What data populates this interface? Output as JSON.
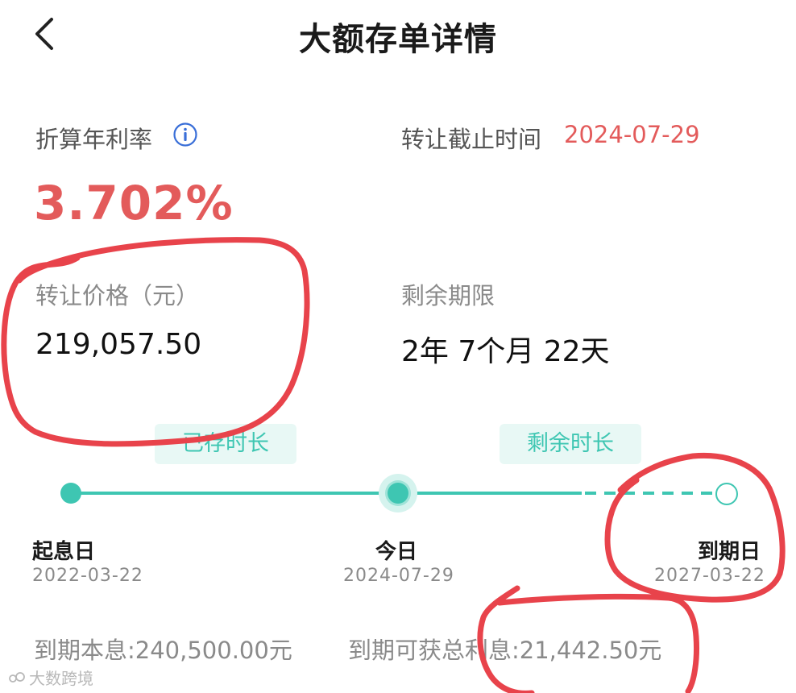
{
  "header": {
    "back_icon": "chevron-left-icon",
    "title": "大额存单详情"
  },
  "rate": {
    "label": "折算年利率",
    "value": "3.702%",
    "info_icon": "info-icon"
  },
  "deadline": {
    "label": "转让截止时间",
    "value": "2024-07-29"
  },
  "price": {
    "label": "转让价格（元）",
    "value": "219,057.50"
  },
  "remaining_term": {
    "label": "剩余期限",
    "value": "2年 7个月 22天"
  },
  "timeline": {
    "elapsed_label": "已存时长",
    "remaining_label": "剩余时长",
    "nodes": [
      {
        "label": "起息日",
        "date": "2022-03-22"
      },
      {
        "label": "今日",
        "date": "2024-07-29"
      },
      {
        "label": "到期日",
        "date": "2027-03-22"
      }
    ]
  },
  "summary": {
    "principal_interest": "到期本息:240,500.00元",
    "total_interest": "到期可获总利息:21,442.50元"
  },
  "watermark": {
    "text": "大数跨境"
  },
  "colors": {
    "accent": "#3ec6b2",
    "highlight_red": "#e35b5b",
    "annotation_red": "#e8434b"
  }
}
